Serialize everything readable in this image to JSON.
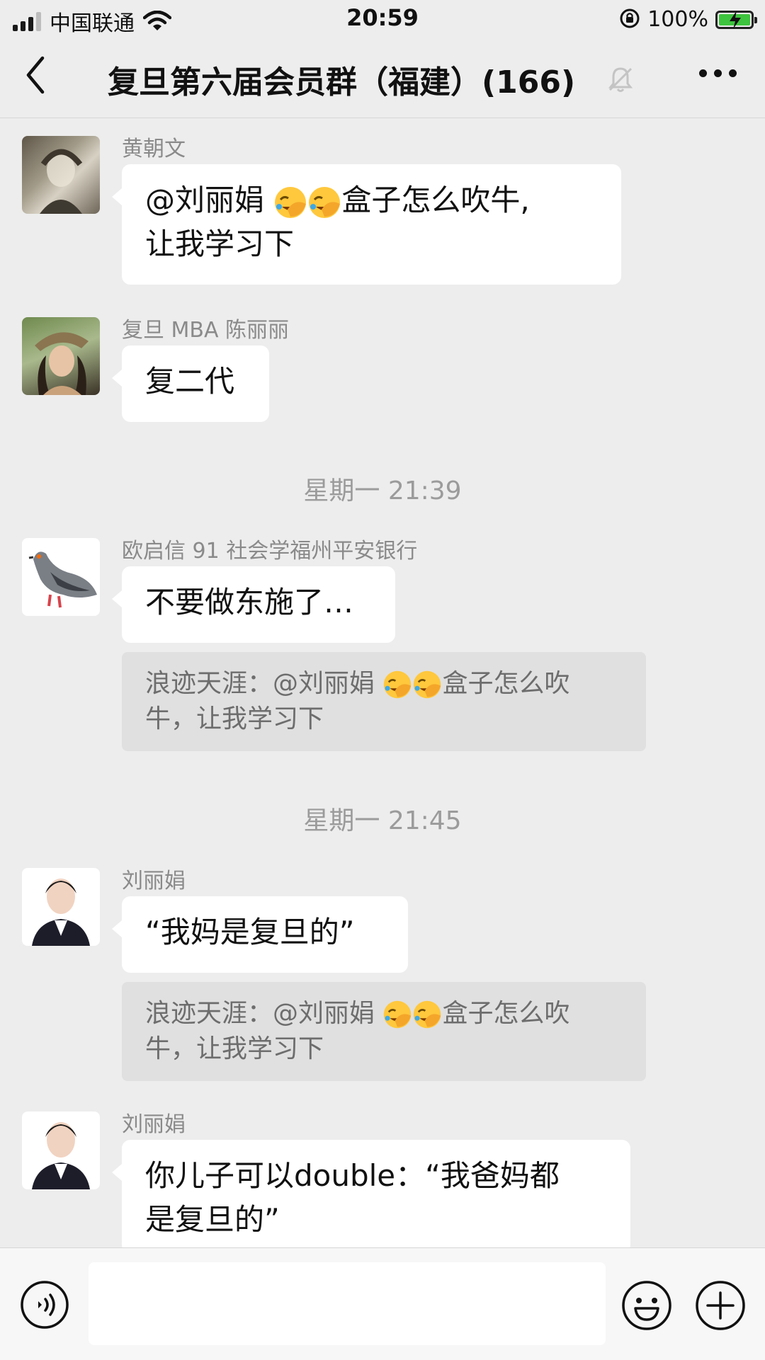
{
  "status_bar": {
    "carrier": "中国联通",
    "time": "20:59",
    "battery_percent": "100%",
    "battery_level": 1.0,
    "icons": [
      "signal-icon",
      "wifi-icon",
      "orientation-lock-icon",
      "battery-charging-icon"
    ]
  },
  "nav": {
    "title": "复旦第六届会员群（福建）(166)",
    "icons": [
      "back-icon",
      "mute-bell-icon",
      "more-icon"
    ]
  },
  "messages": [
    {
      "sender": "黄朝文",
      "lines": [
        {
          "pre": "@刘丽娟 ",
          "emojis": 2,
          "post": "盒子怎么吹牛,"
        },
        {
          "pre": "让我学习下",
          "emojis": 0,
          "post": ""
        }
      ]
    },
    {
      "sender": "复旦 MBA 陈丽丽",
      "text": "复二代"
    },
    {
      "timestamp": "星期一 21:39"
    },
    {
      "sender": "欧启信 91 社会学福州平安银行",
      "text": "不要做东施了…",
      "quote": {
        "pre": "浪迹天涯：@刘丽娟 ",
        "emojis": 2,
        "post": "盒子怎么吹",
        "line2": "牛，让我学习下"
      }
    },
    {
      "timestamp": "星期一 21:45"
    },
    {
      "sender": "刘丽娟",
      "text": "“我妈是复旦的”",
      "quote": {
        "pre": "浪迹天涯：@刘丽娟 ",
        "emojis": 2,
        "post": "盒子怎么吹",
        "line2": "牛，让我学习下"
      }
    },
    {
      "sender": "刘丽娟",
      "line1": "你儿子可以double：“我爸妈都",
      "line2": "是复旦的”"
    }
  ],
  "input_bar": {
    "icons": [
      "voice-icon",
      "emoji-icon",
      "plus-icon"
    ]
  }
}
